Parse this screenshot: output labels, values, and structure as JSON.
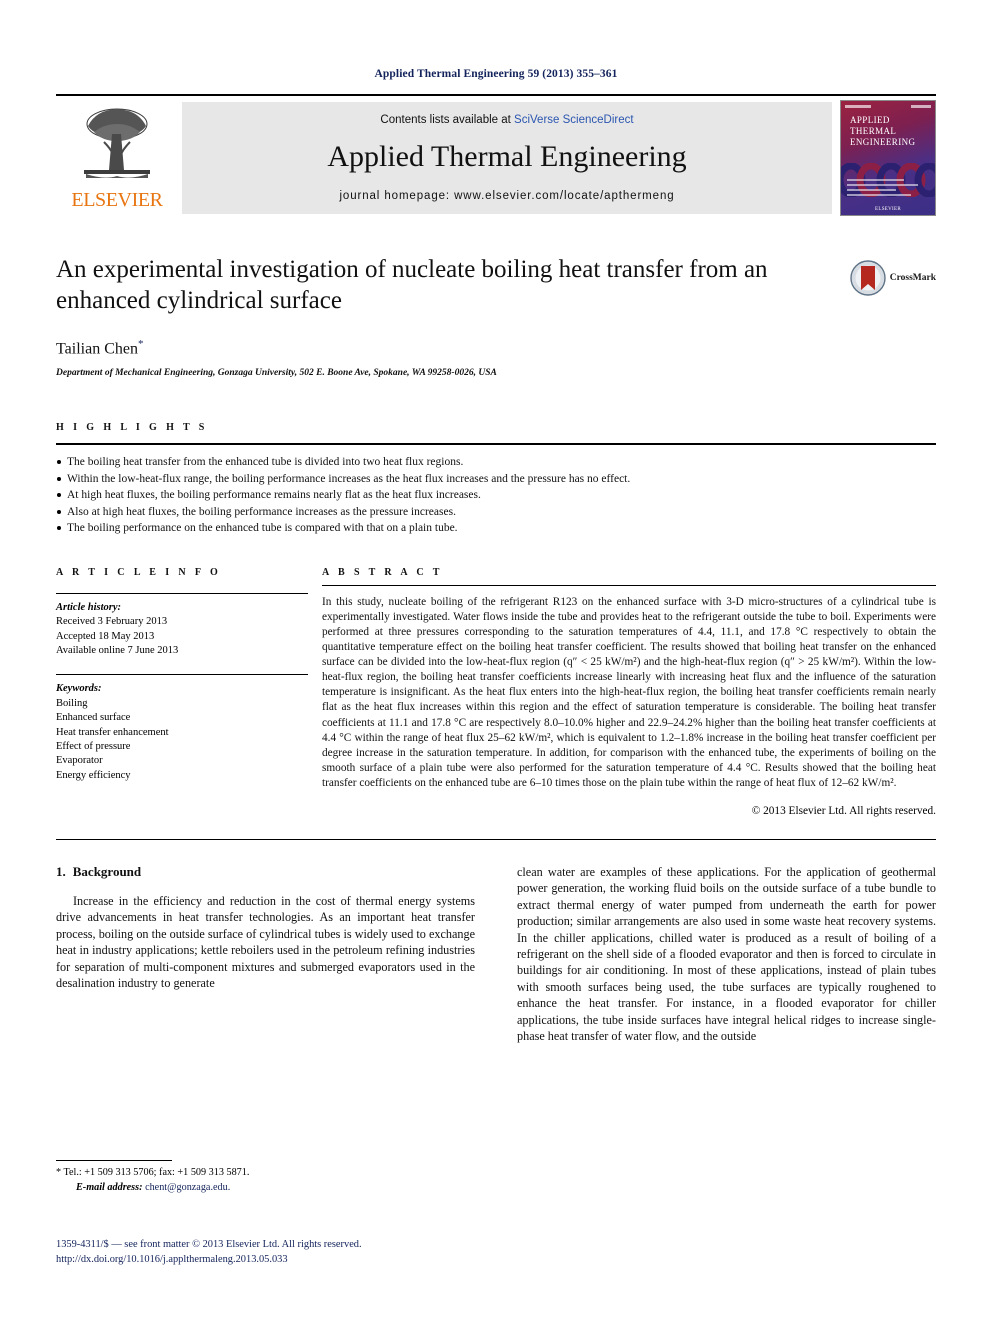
{
  "running_head": "Applied Thermal Engineering 59 (2013) 355–361",
  "masthead": {
    "publisher_name": "ELSEVIER",
    "contents_prefix": "Contents lists available at ",
    "contents_link": "SciVerse ScienceDirect",
    "journal_name": "Applied Thermal Engineering",
    "homepage": "journal homepage: www.elsevier.com/locate/apthermeng",
    "cover_title_line1": "APPLIED",
    "cover_title_line2": "THERMAL",
    "cover_title_line3": "ENGINEERING"
  },
  "article": {
    "title": "An experimental investigation of nucleate boiling heat transfer from an enhanced cylindrical surface",
    "crossmark_label": "CrossMark",
    "author": "Tailian Chen",
    "author_marker": "*",
    "affiliation": "Department of Mechanical Engineering, Gonzaga University, 502 E. Boone Ave, Spokane, WA 99258-0026, USA"
  },
  "highlights": {
    "heading": "H I G H L I G H T S",
    "items": [
      "The boiling heat transfer from the enhanced tube is divided into two heat flux regions.",
      "Within the low-heat-flux range, the boiling performance increases as the heat flux increases and the pressure has no effect.",
      "At high heat fluxes, the boiling performance remains nearly flat as the heat flux increases.",
      "Also at high heat fluxes, the boiling performance increases as the pressure increases.",
      "The boiling performance on the enhanced tube is compared with that on a plain tube."
    ]
  },
  "article_info": {
    "heading": "A R T I C L E   I N F O",
    "history_title": "Article history:",
    "history": [
      "Received 3 February 2013",
      "Accepted 18 May 2013",
      "Available online 7 June 2013"
    ],
    "keywords_title": "Keywords:",
    "keywords": [
      "Boiling",
      "Enhanced surface",
      "Heat transfer enhancement",
      "Effect of pressure",
      "Evaporator",
      "Energy efficiency"
    ]
  },
  "abstract": {
    "heading": "A B S T R A C T",
    "text": "In this study, nucleate boiling of the refrigerant R123 on the enhanced surface with 3-D micro-structures of a cylindrical tube is experimentally investigated. Water flows inside the tube and provides heat to the refrigerant outside the tube to boil. Experiments were performed at three pressures corresponding to the saturation temperatures of 4.4, 11.1, and 17.8 °C respectively to obtain the quantitative temperature effect on the boiling heat transfer coefficient. The results showed that boiling heat transfer on the enhanced surface can be divided into the low-heat-flux region (q″ < 25 kW/m²) and the high-heat-flux region (q″ > 25 kW/m²). Within the low-heat-flux region, the boiling heat transfer coefficients increase linearly with increasing heat flux and the influence of the saturation temperature is insignificant. As the heat flux enters into the high-heat-flux region, the boiling heat transfer coefficients remain nearly flat as the heat flux increases within this region and the effect of saturation temperature is considerable. The boiling heat transfer coefficients at 11.1 and 17.8 °C are respectively 8.0–10.0% higher and 22.9–24.2% higher than the boiling heat transfer coefficients at 4.4 °C within the range of heat flux 25–62 kW/m², which is equivalent to 1.2–1.8% increase in the boiling heat transfer coefficient per degree increase in the saturation temperature. In addition, for comparison with the enhanced tube, the experiments of boiling on the smooth surface of a plain tube were also performed for the saturation temperature of 4.4 °C. Results showed that the boiling heat transfer coefficients on the enhanced tube are 6–10 times those on the plain tube within the range of heat flux of 12–62 kW/m².",
    "copyright": "© 2013 Elsevier Ltd. All rights reserved."
  },
  "body": {
    "section_number": "1.",
    "section_title": "Background",
    "left_paragraph": "Increase in the efficiency and reduction in the cost of thermal energy systems drive advancements in heat transfer technologies. As an important heat transfer process, boiling on the outside surface of cylindrical tubes is widely used to exchange heat in industry applications; kettle reboilers used in the petroleum refining industries for separation of multi-component mixtures and submerged evaporators used in the desalination industry to generate",
    "right_paragraph": "clean water are examples of these applications. For the application of geothermal power generation, the working fluid boils on the outside surface of a tube bundle to extract thermal energy of water pumped from underneath the earth for power production; similar arrangements are also used in some waste heat recovery systems. In the chiller applications, chilled water is produced as a result of boiling of a refrigerant on the shell side of a flooded evaporator and then is forced to circulate in buildings for air conditioning. In most of these applications, instead of plain tubes with smooth surfaces being used, the tube surfaces are typically roughened to enhance the heat transfer. For instance, in a flooded evaporator for chiller applications, the tube inside surfaces have integral helical ridges to increase single-phase heat transfer of water flow, and the outside"
  },
  "footnote": {
    "marker": "*",
    "contact": "Tel.: +1 509 313 5706; fax: +1 509 313 5871.",
    "email_label": "E-mail address:",
    "email": "chent@gonzaga.edu."
  },
  "footer": {
    "issn_line": "1359-4311/$ — see front matter © 2013 Elsevier Ltd. All rights reserved.",
    "doi": "http://dx.doi.org/10.1016/j.applthermaleng.2013.05.033"
  },
  "colors": {
    "link": "#2b56b0",
    "navy": "#13235b",
    "elsevier_orange": "#e87511",
    "masthead_bg": "#e7e7e7"
  }
}
